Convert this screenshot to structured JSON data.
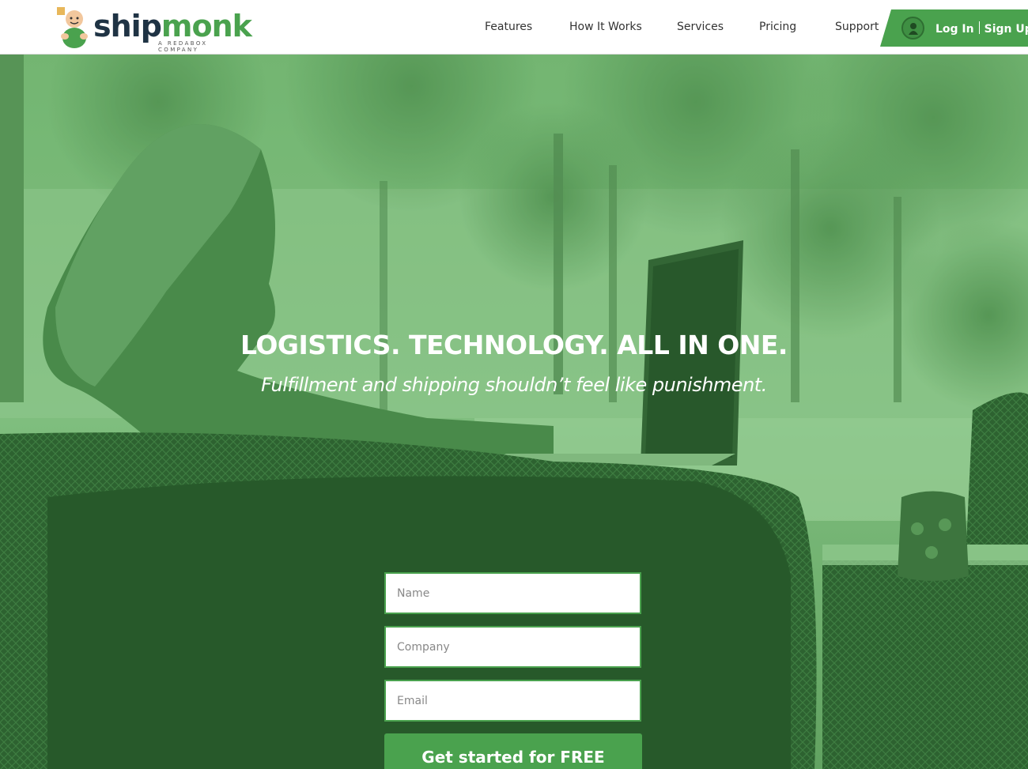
{
  "brand": {
    "logo_ship": "ship",
    "logo_monk": "monk",
    "tagline": "A REDABOX COMPANY",
    "ship_color": "#1f3344",
    "monk_color": "#4aa24e"
  },
  "nav": {
    "items": [
      {
        "label": "Features"
      },
      {
        "label": "How It Works"
      },
      {
        "label": "Services"
      },
      {
        "label": "Pricing"
      },
      {
        "label": "Support"
      }
    ],
    "login_label": "Log In",
    "signup_label": "Sign Up",
    "user_icon": "user-icon"
  },
  "hero": {
    "title": "LOGISTICS. TECHNOLOGY. ALL IN ONE.",
    "subtitle": "Fulfillment and shipping shouldn’t feel like punishment.",
    "background": "woman-on-laptop-patio-photo-green-tint"
  },
  "form": {
    "name_placeholder": "Name",
    "company_placeholder": "Company",
    "email_placeholder": "Email",
    "submit_label": "Get started for FREE"
  },
  "colors": {
    "accent": "#4aa24e",
    "overlay_light": "#9ed39a",
    "overlay_dark": "#24502a"
  }
}
